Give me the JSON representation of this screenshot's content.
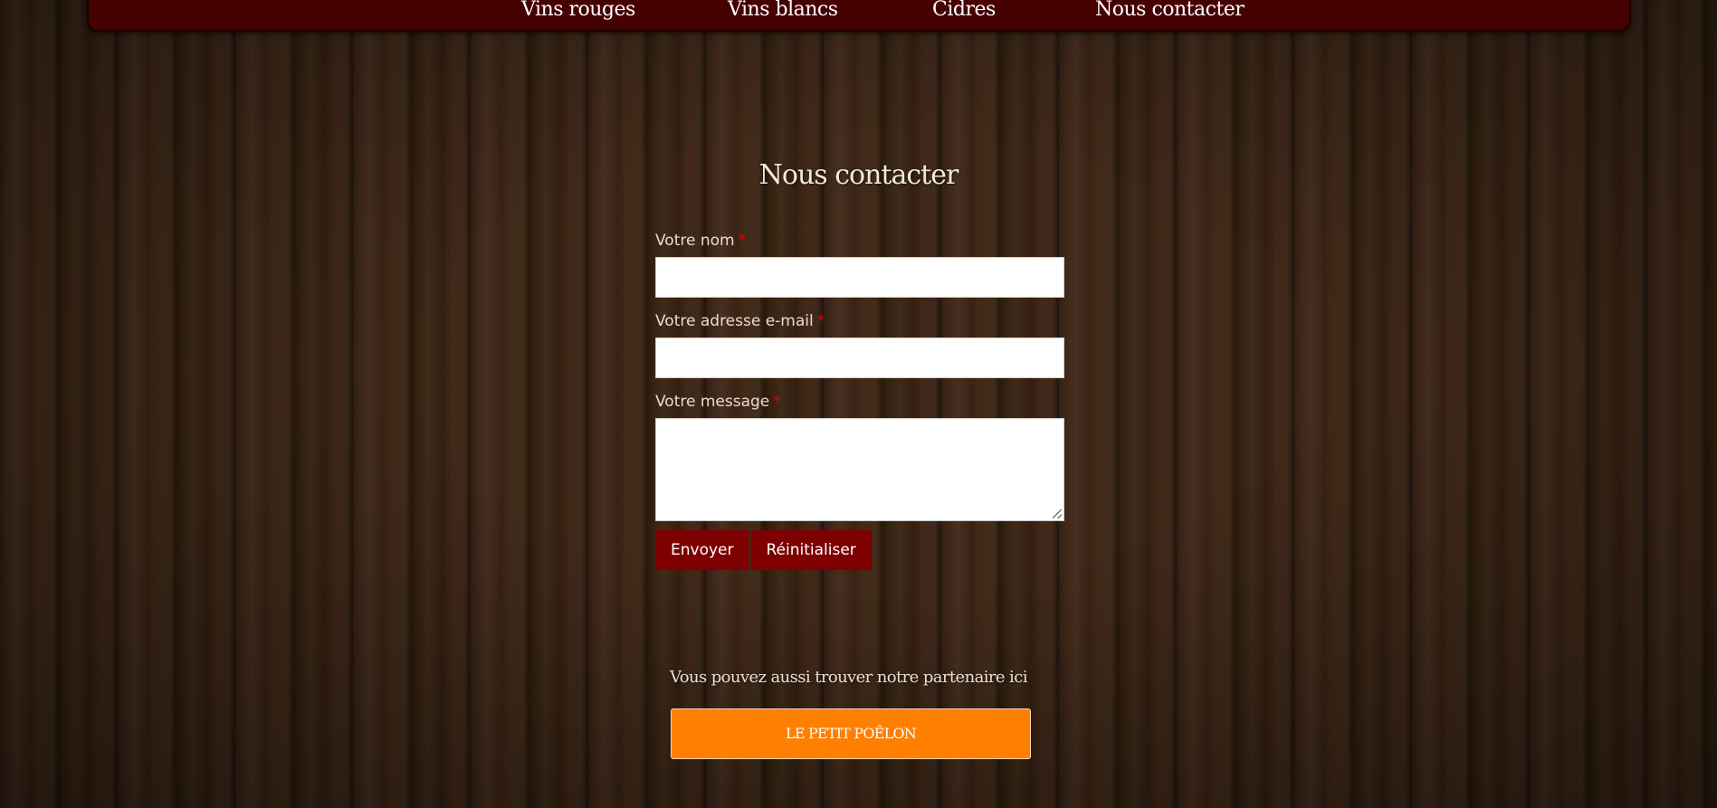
{
  "nav": {
    "items": [
      {
        "label": "Vins rouges"
      },
      {
        "label": "Vins blancs"
      },
      {
        "label": "Cidres"
      },
      {
        "label": "Nous contacter"
      }
    ]
  },
  "page": {
    "title": "Nous contacter"
  },
  "form": {
    "name_label": "Votre nom",
    "email_label": "Votre adresse e-mail",
    "message_label": "Votre message",
    "required_marker": "*",
    "name_value": "",
    "email_value": "",
    "message_value": "",
    "submit_label": "Envoyer",
    "reset_label": "Réinitialiser"
  },
  "partner": {
    "text": "Vous pouvez aussi trouver notre partenaire ici",
    "button_label": "LE PETIT POÊLON"
  },
  "colors": {
    "nav_bg": "#450000",
    "button_bg": "#7e0000",
    "partner_button_bg": "#ff7f00",
    "required": "#e00000"
  }
}
